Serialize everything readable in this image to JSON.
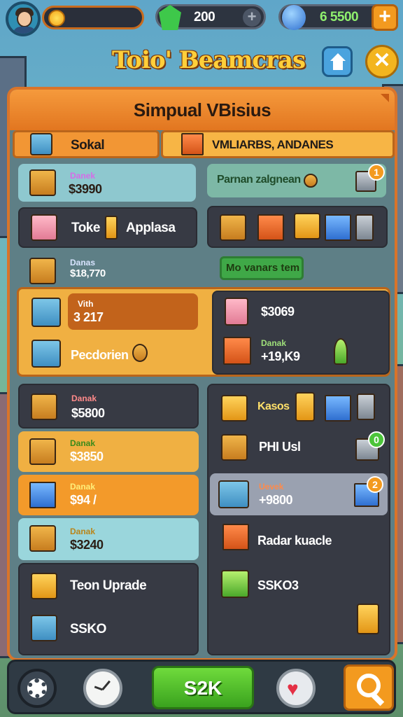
{
  "topbar": {
    "gems_value": "200",
    "cash_value": "6 5500",
    "plus_label": "+",
    "plus_small_label": "+"
  },
  "header": {
    "title": "Toio' Beamcras",
    "close_label": "✕"
  },
  "panel": {
    "title": "Simpual VBisius",
    "tabs": [
      {
        "label": "Sokal"
      },
      {
        "label": "VMLIARBS, ANDANES"
      }
    ]
  },
  "left_column": [
    {
      "small": "Danek",
      "value": "$3990"
    },
    {
      "name": "Toke",
      "name2": "Applasa"
    },
    {
      "small": "Danas",
      "value": "$18,770"
    },
    {
      "small": "Vith",
      "value": "3 217"
    },
    {
      "name": "Pecdorien"
    },
    {
      "small": "Danak",
      "value": "$5800"
    },
    {
      "small": "Danak",
      "value": "$3850"
    },
    {
      "small": "Danak",
      "value": "$94 /"
    },
    {
      "small": "Danak",
      "value": "$3240"
    },
    {
      "name": "Teon Uprade"
    },
    {
      "name": "SSKO"
    }
  ],
  "right_column": [
    {
      "name": "Parnan zalgnean",
      "badge": "1"
    },
    {
      "pill": "Mo vanars tem"
    },
    {
      "value": "$3069"
    },
    {
      "small": "Danak",
      "value": "+19,K9"
    },
    {
      "name": "Kasos"
    },
    {
      "name": "PHI Usl",
      "badge": "0"
    },
    {
      "small": "Uevek",
      "value": "+9800",
      "badge": "2"
    },
    {
      "name": "Radar kuacle"
    },
    {
      "name": "SSKO3"
    }
  ],
  "bottombar": {
    "main_label": "S2K"
  },
  "colors": {
    "accent_orange": "#f39a1f",
    "panel_bg": "#5e7f86",
    "cash_green": "#8ff06e",
    "main_button_green": "#3aa21e"
  }
}
